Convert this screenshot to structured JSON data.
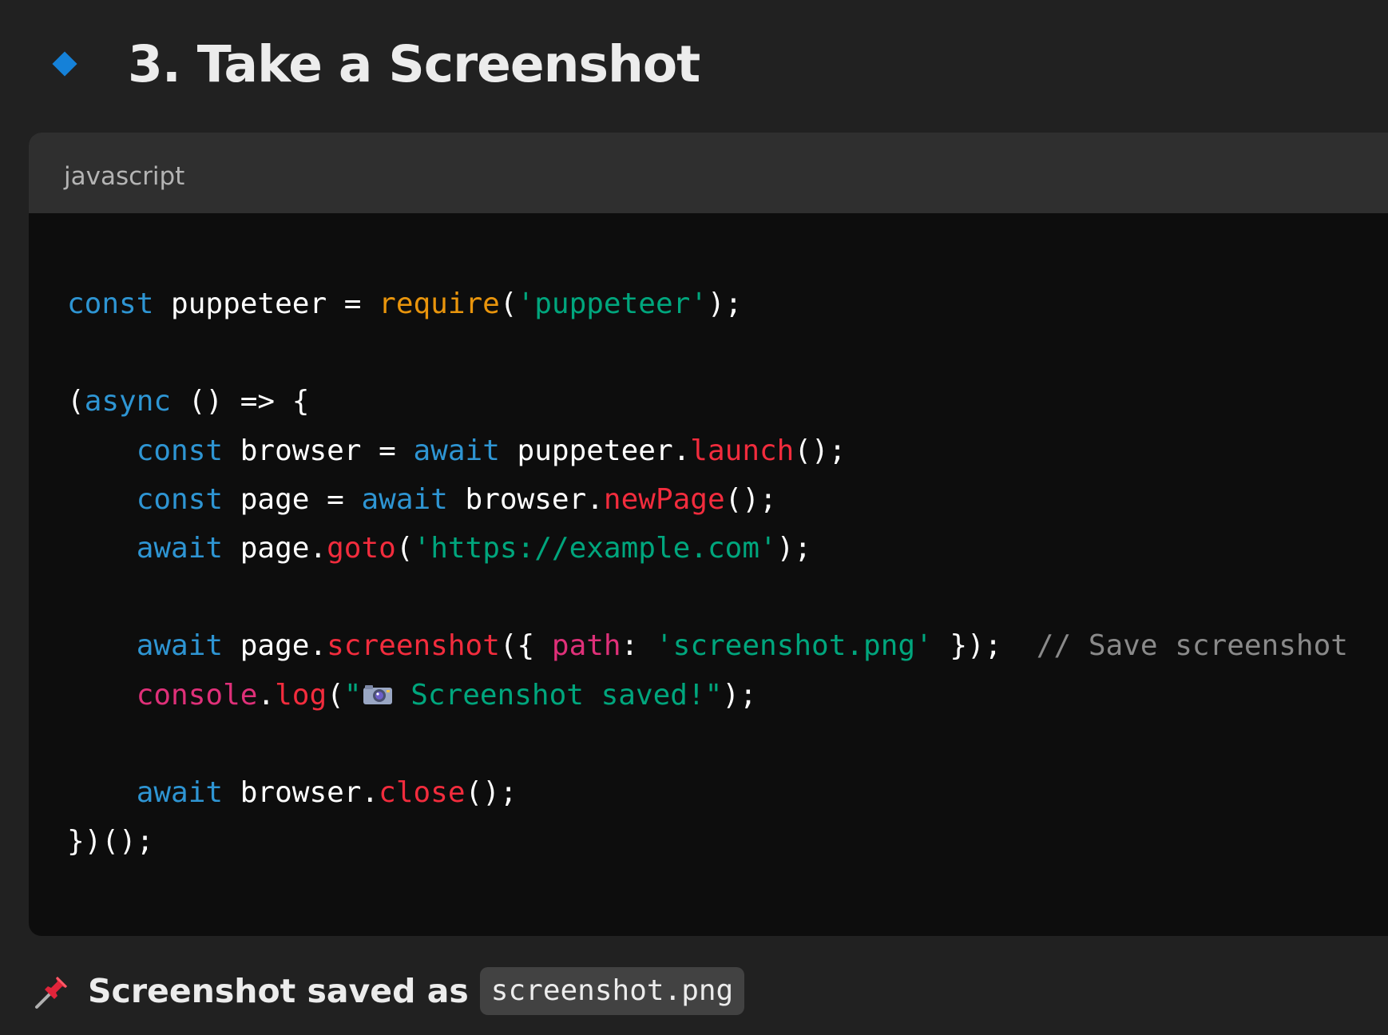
{
  "heading": {
    "title": "3. Take a Screenshot"
  },
  "code_block": {
    "language": "javascript",
    "lines": [
      [
        {
          "t": "const",
          "c": "kw"
        },
        {
          "t": " puppeteer = ",
          "c": "pl"
        },
        {
          "t": "require",
          "c": "req"
        },
        {
          "t": "(",
          "c": "pl"
        },
        {
          "t": "'puppeteer'",
          "c": "str"
        },
        {
          "t": ");",
          "c": "pl"
        }
      ],
      [],
      [
        {
          "t": "(",
          "c": "pl"
        },
        {
          "t": "async",
          "c": "kw"
        },
        {
          "t": " () => {",
          "c": "pl"
        }
      ],
      [
        {
          "t": "    ",
          "c": "pl"
        },
        {
          "t": "const",
          "c": "kw"
        },
        {
          "t": " browser = ",
          "c": "pl"
        },
        {
          "t": "await",
          "c": "kw"
        },
        {
          "t": " puppeteer.",
          "c": "pl"
        },
        {
          "t": "launch",
          "c": "fn"
        },
        {
          "t": "();",
          "c": "pl"
        }
      ],
      [
        {
          "t": "    ",
          "c": "pl"
        },
        {
          "t": "const",
          "c": "kw"
        },
        {
          "t": " page = ",
          "c": "pl"
        },
        {
          "t": "await",
          "c": "kw"
        },
        {
          "t": " browser.",
          "c": "pl"
        },
        {
          "t": "newPage",
          "c": "fn"
        },
        {
          "t": "();",
          "c": "pl"
        }
      ],
      [
        {
          "t": "    ",
          "c": "pl"
        },
        {
          "t": "await",
          "c": "kw"
        },
        {
          "t": " page.",
          "c": "pl"
        },
        {
          "t": "goto",
          "c": "fn"
        },
        {
          "t": "(",
          "c": "pl"
        },
        {
          "t": "'https://example.com'",
          "c": "str"
        },
        {
          "t": ");",
          "c": "pl"
        }
      ],
      [],
      [
        {
          "t": "    ",
          "c": "pl"
        },
        {
          "t": "await",
          "c": "kw"
        },
        {
          "t": " page.",
          "c": "pl"
        },
        {
          "t": "screenshot",
          "c": "fn"
        },
        {
          "t": "({ ",
          "c": "pl"
        },
        {
          "t": "path",
          "c": "prop"
        },
        {
          "t": ": ",
          "c": "pl"
        },
        {
          "t": "'screenshot.png'",
          "c": "str"
        },
        {
          "t": " });  ",
          "c": "pl"
        },
        {
          "t": "// Save screenshot",
          "c": "cm"
        }
      ],
      [
        {
          "t": "    ",
          "c": "pl"
        },
        {
          "t": "console",
          "c": "prop"
        },
        {
          "t": ".",
          "c": "pl"
        },
        {
          "t": "log",
          "c": "fn"
        },
        {
          "t": "(",
          "c": "pl"
        },
        {
          "t": "\"",
          "c": "str"
        },
        {
          "t": "camera-emoji",
          "c": "icon"
        },
        {
          "t": " Screenshot saved!\"",
          "c": "str"
        },
        {
          "t": ");",
          "c": "pl"
        }
      ],
      [],
      [
        {
          "t": "    ",
          "c": "pl"
        },
        {
          "t": "await",
          "c": "kw"
        },
        {
          "t": " browser.",
          "c": "pl"
        },
        {
          "t": "close",
          "c": "fn"
        },
        {
          "t": "();",
          "c": "pl"
        }
      ],
      [
        {
          "t": "})();",
          "c": "pl"
        }
      ]
    ]
  },
  "footer": {
    "icon": "pushpin-icon",
    "label": "Screenshot saved as",
    "filename": "screenshot.png"
  },
  "colors": {
    "background": "#212121",
    "code_background": "#0d0d0d",
    "header_background": "#2f2f2f",
    "accent": "#1581d8",
    "keyword": "#2e95d3",
    "function": "#f22c3d",
    "string": "#00a67d",
    "property": "#df3079",
    "require": "#e9950c",
    "comment": "#8a8a8a"
  }
}
